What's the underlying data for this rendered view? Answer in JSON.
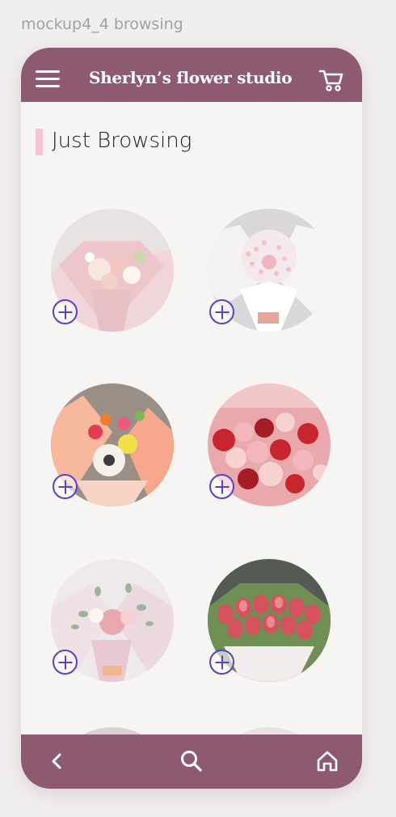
{
  "frame_label": "mockup4_4 browsing",
  "header": {
    "title": "Sherlyn’s flower studio",
    "menu_icon": "hamburger-menu-icon",
    "cart_icon": "shopping-cart-icon",
    "background": "#8d5a72"
  },
  "section": {
    "title": "Just Browsing",
    "accent_color": "#f6c3d6"
  },
  "products": [
    {
      "name": "pastel-pink-bouquet",
      "palette": [
        "#f0d6d6",
        "#e8b8b6",
        "#f7f0e8",
        "#c9d8a8"
      ]
    },
    {
      "name": "babys-breath-rose-bouquet",
      "palette": [
        "#f3ecef",
        "#f2c1c4",
        "#ffffff",
        "#d98b92"
      ]
    },
    {
      "name": "peach-gerbera-bouquet",
      "palette": [
        "#f8b79a",
        "#e53b57",
        "#f0e14a",
        "#f5f1ea"
      ]
    },
    {
      "name": "red-pink-rose-bouquet",
      "palette": [
        "#c8262e",
        "#f1b7bc",
        "#f6d3d0",
        "#a61c25"
      ]
    },
    {
      "name": "eucalyptus-rose-bouquet",
      "palette": [
        "#f1dfe6",
        "#e9a8ad",
        "#9db49a",
        "#fff4f4"
      ]
    },
    {
      "name": "pink-tulip-bouquet",
      "palette": [
        "#d4535f",
        "#e98a8f",
        "#6f8f55",
        "#f3ecec"
      ]
    }
  ],
  "add_button_icon": "plus-circle-icon",
  "bottom_nav": {
    "back_icon": "chevron-left-icon",
    "search_icon": "search-icon",
    "home_icon": "home-icon"
  }
}
